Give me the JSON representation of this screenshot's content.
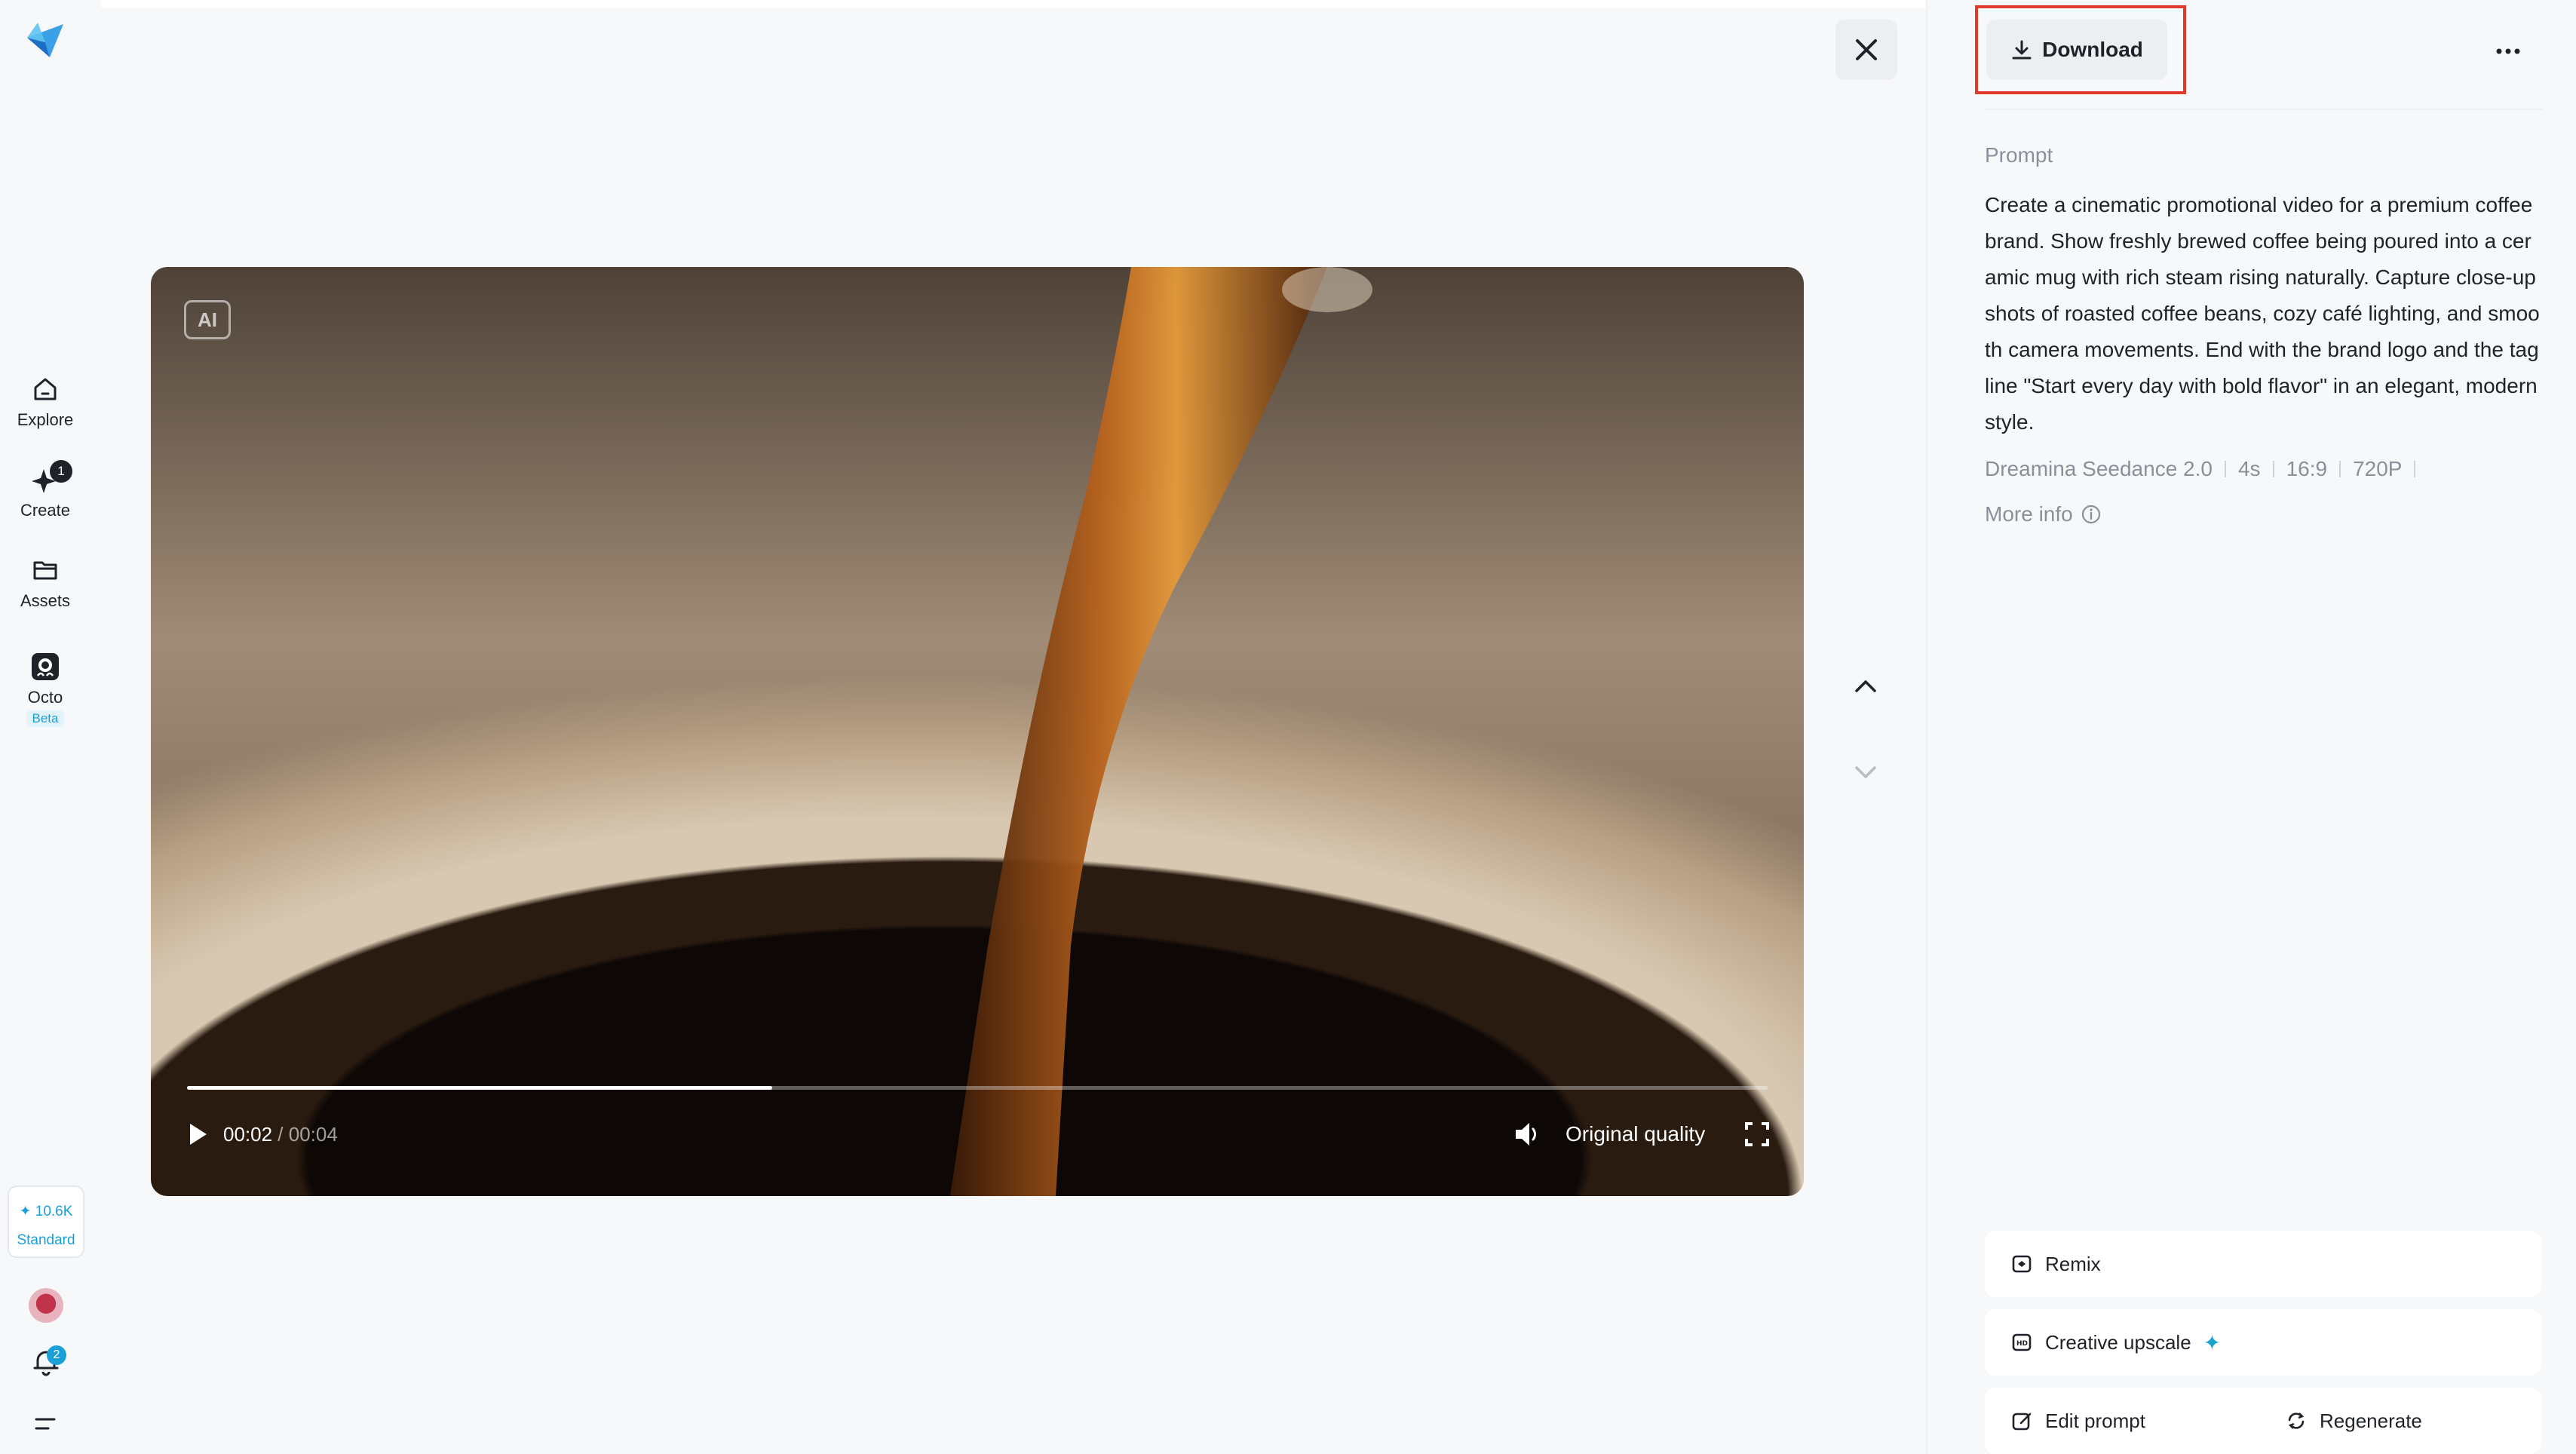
{
  "nav": {
    "items": [
      {
        "label": "Explore"
      },
      {
        "label": "Create",
        "badge": "1"
      },
      {
        "label": "Assets"
      },
      {
        "label": "Octo",
        "tag": "Beta"
      }
    ],
    "credits": {
      "amount": "10.6K",
      "plan": "Standard"
    },
    "notifications": "2"
  },
  "player": {
    "ai_tag": "AI",
    "current_time": "00:02",
    "duration": "00:04",
    "time_separator": " / ",
    "progress": 0.37,
    "quality_label": "Original quality"
  },
  "panel": {
    "download_label": "Download",
    "prompt_label": "Prompt",
    "prompt_text": "Create a cinematic promotional video for a premium coffee brand. Show freshly brewed coffee being poured into a ceramic mug with rich steam rising naturally. Capture close-up shots of roasted coffee beans, cozy café lighting, and smooth camera movements. End with the brand logo and the tagline \"Start every day with bold flavor\" in an elegant, modern style.",
    "meta": [
      "Dreamina Seedance 2.0",
      "4s",
      "16:9",
      "720P"
    ],
    "more_info_label": "More info",
    "actions": {
      "remix": "Remix",
      "creative_upscale": "Creative upscale",
      "edit_prompt": "Edit prompt",
      "regenerate": "Regenerate"
    }
  },
  "colors": {
    "accent": "#1a9fd8",
    "highlight": "#e03a2b",
    "background": "#f7f8fa"
  }
}
